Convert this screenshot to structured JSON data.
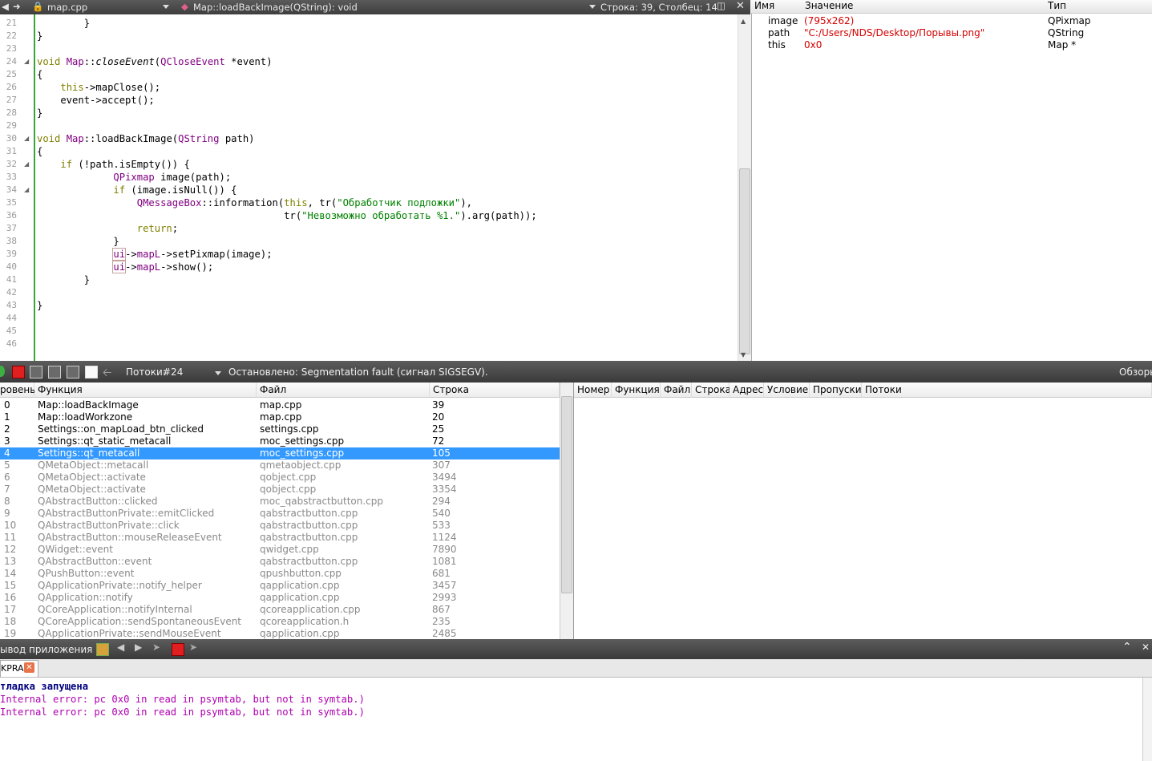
{
  "editor_toolbar": {
    "file": "map.cpp",
    "function": "Map::loadBackImage(QString): void",
    "position": "Строка: 39, Столбец: 14"
  },
  "editor": {
    "lines": [
      {
        "n": "21",
        "segs": [
          [
            "t",
            "        }"
          ]
        ]
      },
      {
        "n": "22",
        "segs": [
          [
            "t",
            "}"
          ]
        ]
      },
      {
        "n": "23",
        "segs": []
      },
      {
        "n": "24",
        "fold": true,
        "segs": [
          [
            "kw",
            "void"
          ],
          [
            "t",
            " "
          ],
          [
            "ty",
            "Map"
          ],
          [
            "t",
            "::"
          ],
          [
            "it",
            "closeEvent"
          ],
          [
            "t",
            "("
          ],
          [
            "ty",
            "QCloseEvent"
          ],
          [
            "t",
            " *event)"
          ]
        ]
      },
      {
        "n": "25",
        "segs": [
          [
            "t",
            "{"
          ]
        ]
      },
      {
        "n": "26",
        "segs": [
          [
            "t",
            "    "
          ],
          [
            "kw",
            "this"
          ],
          [
            "t",
            "->mapClose();"
          ]
        ]
      },
      {
        "n": "27",
        "segs": [
          [
            "t",
            "    event->accept();"
          ]
        ]
      },
      {
        "n": "28",
        "segs": [
          [
            "t",
            "}"
          ]
        ]
      },
      {
        "n": "29",
        "segs": []
      },
      {
        "n": "30",
        "fold": true,
        "segs": [
          [
            "kw",
            "void"
          ],
          [
            "t",
            " "
          ],
          [
            "ty",
            "Map"
          ],
          [
            "t",
            "::loadBackImage("
          ],
          [
            "ty",
            "QString"
          ],
          [
            "t",
            " path)"
          ]
        ]
      },
      {
        "n": "31",
        "segs": [
          [
            "t",
            "{"
          ]
        ]
      },
      {
        "n": "32",
        "fold": true,
        "segs": [
          [
            "t",
            "    "
          ],
          [
            "kw",
            "if"
          ],
          [
            "t",
            " (!path.isEmpty()) {"
          ]
        ]
      },
      {
        "n": "33",
        "segs": [
          [
            "t",
            "             "
          ],
          [
            "ty",
            "QPixmap"
          ],
          [
            "t",
            " image(path);"
          ]
        ]
      },
      {
        "n": "34",
        "fold": true,
        "segs": [
          [
            "t",
            "             "
          ],
          [
            "kw",
            "if"
          ],
          [
            "t",
            " (image.isNull()) {"
          ]
        ]
      },
      {
        "n": "35",
        "segs": [
          [
            "t",
            "                 "
          ],
          [
            "ty",
            "QMessageBox"
          ],
          [
            "t",
            "::information("
          ],
          [
            "kw",
            "this"
          ],
          [
            "t",
            ", tr("
          ],
          [
            "st",
            "\"Обработчик подложки\""
          ],
          [
            "t",
            "),"
          ]
        ]
      },
      {
        "n": "36",
        "segs": [
          [
            "t",
            "                                          tr("
          ],
          [
            "st",
            "\"Невозможно обработать %1.\""
          ],
          [
            "t",
            ").arg(path));"
          ]
        ]
      },
      {
        "n": "37",
        "segs": [
          [
            "t",
            "                 "
          ],
          [
            "kw",
            "return"
          ],
          [
            "t",
            ";"
          ]
        ]
      },
      {
        "n": "38",
        "segs": [
          [
            "t",
            "             }"
          ]
        ]
      },
      {
        "n": "39",
        "segs": [
          [
            "t",
            "             "
          ],
          [
            "tyh",
            "ui"
          ],
          [
            "t",
            "->"
          ],
          [
            "ty",
            "mapL"
          ],
          [
            "t",
            "->setPixmap(image);"
          ]
        ]
      },
      {
        "n": "40",
        "segs": [
          [
            "t",
            "             "
          ],
          [
            "tyh",
            "ui"
          ],
          [
            "t",
            "->"
          ],
          [
            "ty",
            "mapL"
          ],
          [
            "t",
            "->show();"
          ]
        ]
      },
      {
        "n": "41",
        "segs": [
          [
            "t",
            "        }"
          ]
        ]
      },
      {
        "n": "42",
        "segs": []
      },
      {
        "n": "43",
        "segs": [
          [
            "t",
            "}"
          ]
        ]
      },
      {
        "n": "44",
        "segs": []
      },
      {
        "n": "45",
        "segs": []
      },
      {
        "n": "46",
        "segs": []
      }
    ]
  },
  "locals": {
    "headers": {
      "name": "Имя",
      "value": "Значение",
      "type": "Тип"
    },
    "rows": [
      {
        "name": "image",
        "value": "(795x262)",
        "type": "QPixmap"
      },
      {
        "name": "path",
        "value": "\"C:/Users/NDS/Desktop/Порывы.png\"",
        "type": "QString"
      },
      {
        "name": "this",
        "value": "0x0",
        "type": "Map *"
      }
    ]
  },
  "debug_toolbar": {
    "threads_label": "Потоки:",
    "thread_value": "#24",
    "status": "Остановлено: Segmentation fault (сигнал SIGSEGV).",
    "right_label": "Обзоры"
  },
  "stack": {
    "headers": {
      "level": "ровень",
      "function": "Функция",
      "file": "Файл",
      "line": "Строка"
    },
    "rows": [
      {
        "l": "0",
        "f": "Map::loadBackImage",
        "file": "map.cpp",
        "line": "39",
        "state": "normal"
      },
      {
        "l": "1",
        "f": "Map::loadWorkzone",
        "file": "map.cpp",
        "line": "20",
        "state": "normal"
      },
      {
        "l": "2",
        "f": "Settings::on_mapLoad_btn_clicked",
        "file": "settings.cpp",
        "line": "25",
        "state": "normal"
      },
      {
        "l": "3",
        "f": "Settings::qt_static_metacall",
        "file": "moc_settings.cpp",
        "line": "72",
        "state": "normal"
      },
      {
        "l": "4",
        "f": "Settings::qt_metacall",
        "file": "moc_settings.cpp",
        "line": "105",
        "state": "selected"
      },
      {
        "l": "5",
        "f": "QMetaObject::metacall",
        "file": "qmetaobject.cpp",
        "line": "307",
        "state": "dim"
      },
      {
        "l": "6",
        "f": "QMetaObject::activate",
        "file": "qobject.cpp",
        "line": "3494",
        "state": "dim"
      },
      {
        "l": "7",
        "f": "QMetaObject::activate",
        "file": "qobject.cpp",
        "line": "3354",
        "state": "dim"
      },
      {
        "l": "8",
        "f": "QAbstractButton::clicked",
        "file": "moc_qabstractbutton.cpp",
        "line": "294",
        "state": "dim"
      },
      {
        "l": "9",
        "f": "QAbstractButtonPrivate::emitClicked",
        "file": "qabstractbutton.cpp",
        "line": "540",
        "state": "dim"
      },
      {
        "l": "10",
        "f": "QAbstractButtonPrivate::click",
        "file": "qabstractbutton.cpp",
        "line": "533",
        "state": "dim"
      },
      {
        "l": "11",
        "f": "QAbstractButton::mouseReleaseEvent",
        "file": "qabstractbutton.cpp",
        "line": "1124",
        "state": "dim"
      },
      {
        "l": "12",
        "f": "QWidget::event",
        "file": "qwidget.cpp",
        "line": "7890",
        "state": "dim"
      },
      {
        "l": "13",
        "f": "QAbstractButton::event",
        "file": "qabstractbutton.cpp",
        "line": "1081",
        "state": "dim"
      },
      {
        "l": "14",
        "f": "QPushButton::event",
        "file": "qpushbutton.cpp",
        "line": "681",
        "state": "dim"
      },
      {
        "l": "15",
        "f": "QApplicationPrivate::notify_helper",
        "file": "qapplication.cpp",
        "line": "3457",
        "state": "dim"
      },
      {
        "l": "16",
        "f": "QApplication::notify",
        "file": "qapplication.cpp",
        "line": "2993",
        "state": "dim"
      },
      {
        "l": "17",
        "f": "QCoreApplication::notifyInternal",
        "file": "qcoreapplication.cpp",
        "line": "867",
        "state": "dim"
      },
      {
        "l": "18",
        "f": "QCoreApplication::sendSpontaneousEvent",
        "file": "qcoreapplication.h",
        "line": "235",
        "state": "dim"
      },
      {
        "l": "19",
        "f": "QApplicationPrivate::sendMouseEvent",
        "file": "qapplication.cpp",
        "line": "2485",
        "state": "dim"
      }
    ]
  },
  "breakpoints": {
    "headers": [
      "Номер",
      "Функция",
      "Файл",
      "Строка",
      "Адрес",
      "Условие",
      "Пропуски",
      "Потоки"
    ]
  },
  "output_toolbar": {
    "title": "ывод приложения"
  },
  "output_tab": {
    "label": "KPRA"
  },
  "output": {
    "lines": [
      {
        "text": "тладка запущена",
        "color": "#000080",
        "bold": true
      },
      {
        "text": "Internal error: pc 0x0 in read in psymtab, but not in symtab.)",
        "color": "#b000b0",
        "bold": false
      },
      {
        "text": "Internal error: pc 0x0 in read in psymtab, but not in symtab.)",
        "color": "#b000b0",
        "bold": false
      }
    ]
  },
  "colors": {
    "accent": "#3399ff",
    "keyword": "#808000",
    "type": "#800080",
    "string": "#008000",
    "error": "#d40000"
  }
}
